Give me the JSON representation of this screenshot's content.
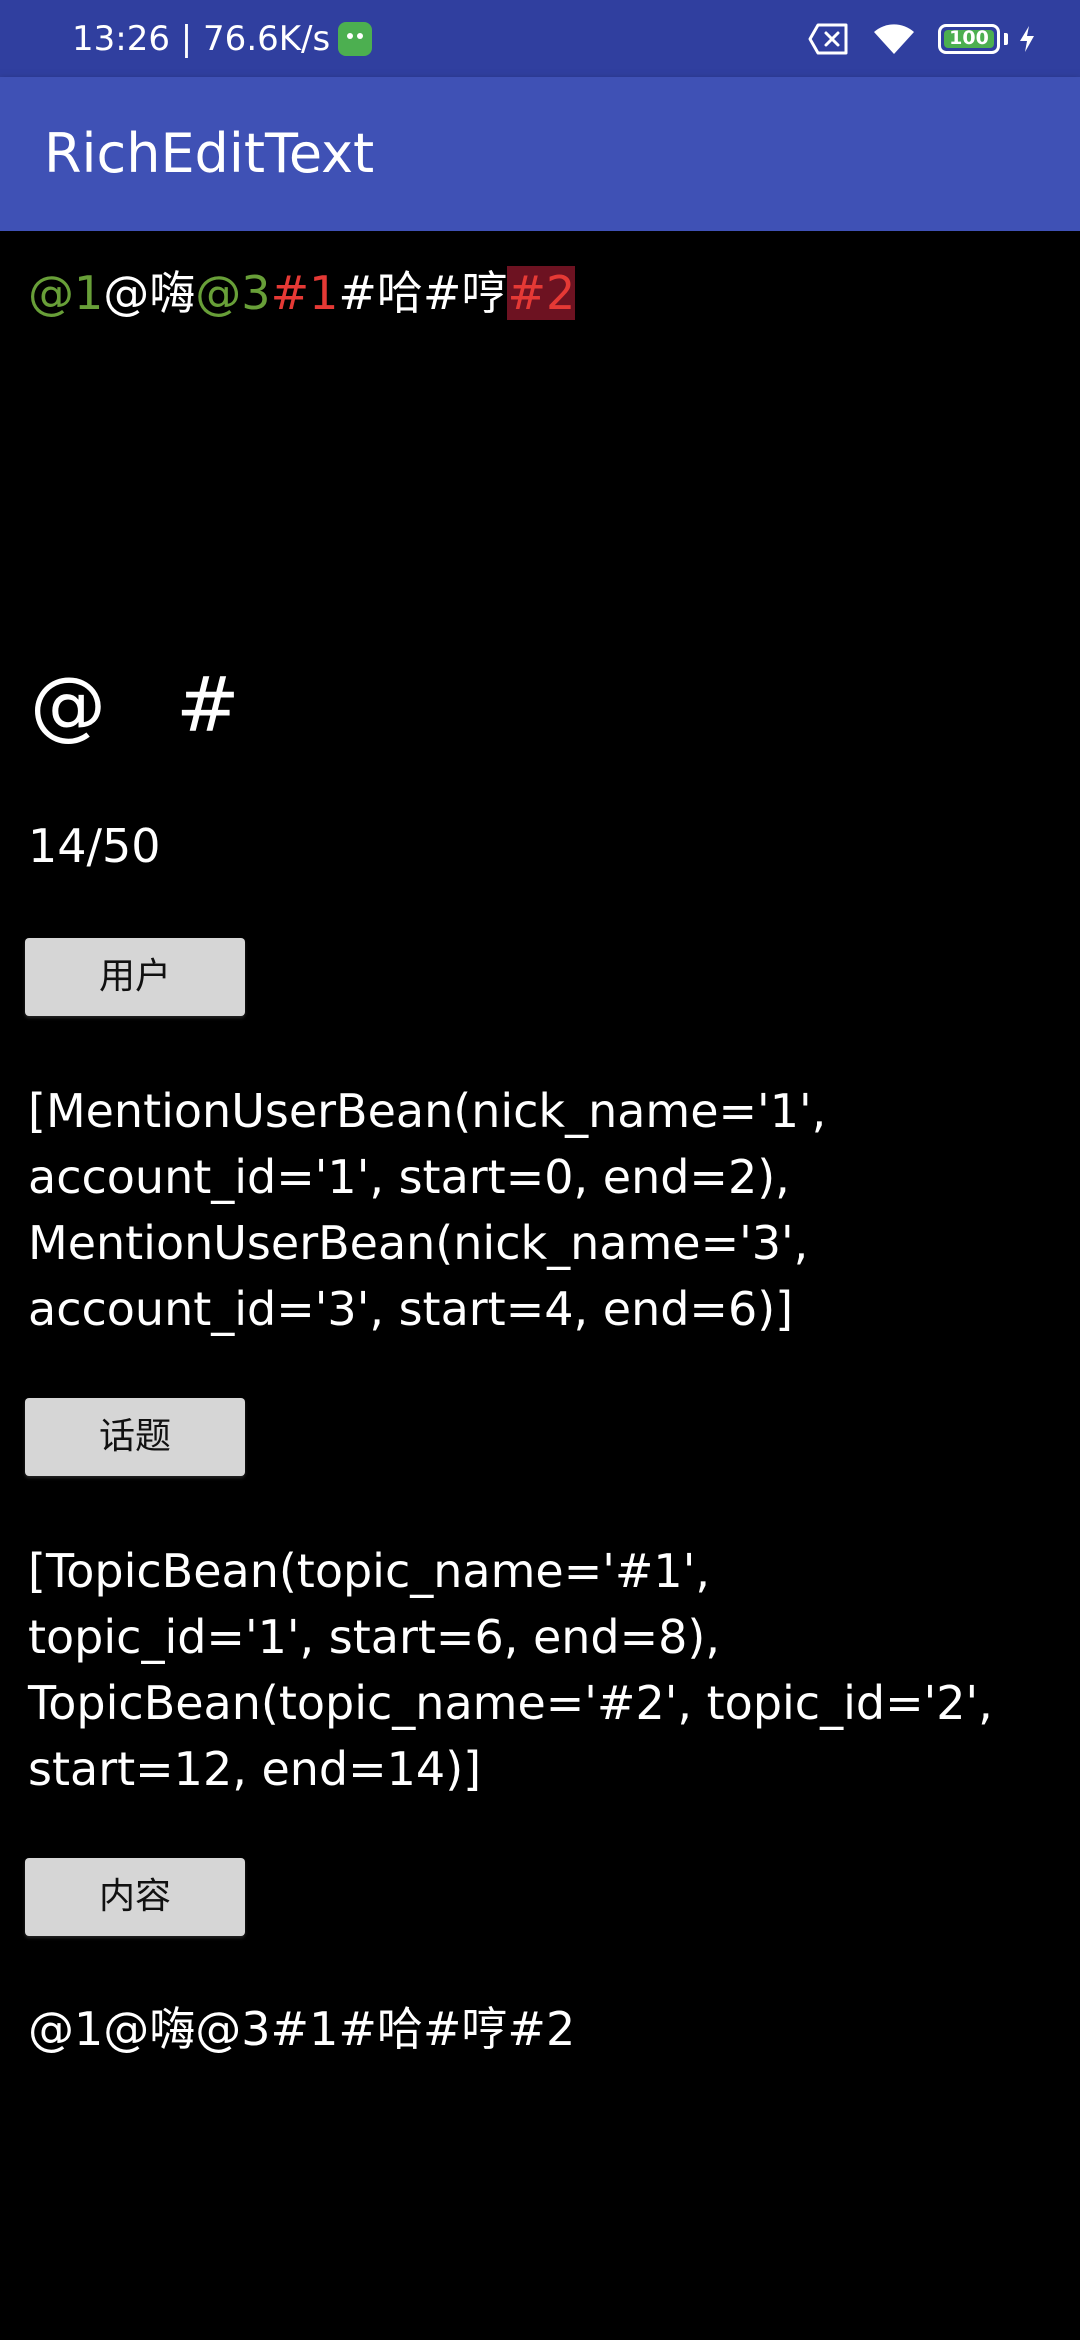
{
  "status_bar": {
    "time_speed": "13:26 | 76.6K/s",
    "battery_level": "100",
    "icons": [
      "app-notification-icon",
      "sim-card-x-icon",
      "wifi-icon",
      "battery-icon",
      "charging-bolt-icon"
    ]
  },
  "toolbar": {
    "title": "RichEditText"
  },
  "editor": {
    "segments": [
      {
        "text": "@1",
        "type": "mention"
      },
      {
        "text": "@嗨",
        "type": "plain"
      },
      {
        "text": "@3",
        "type": "mention"
      },
      {
        "text": "#1",
        "type": "topic"
      },
      {
        "text": "#哈#哼",
        "type": "plain"
      },
      {
        "text": "#2",
        "type": "topic-selected"
      }
    ],
    "colors": {
      "mention": "#689F38",
      "topic": "#E53935",
      "selection_bg": "#6D1221"
    }
  },
  "symbols": {
    "at": "@",
    "hash": "#"
  },
  "counter": "14/50",
  "buttons": {
    "users": "用户",
    "topics": "话题",
    "content": "内容"
  },
  "outputs": {
    "users": "[MentionUserBean(nick_name='1',\naccount_id='1', start=0, end=2),\nMentionUserBean(nick_name='3',\naccount_id='3', start=4, end=6)]",
    "topics": "[TopicBean(topic_name='#1',\ntopic_id='1', start=6, end=8),\nTopicBean(topic_name='#2', topic_id='2',\nstart=12, end=14)]",
    "content": "@1@嗨@3#1#哈#哼#2"
  }
}
